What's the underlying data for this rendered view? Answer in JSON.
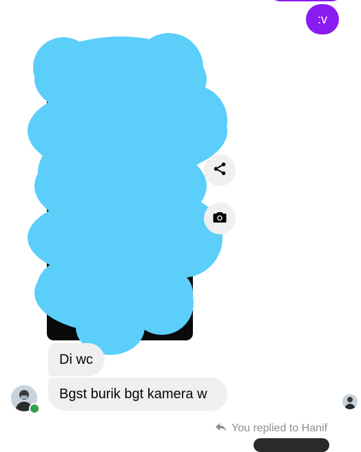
{
  "colors": {
    "brand_purple": "#8a1cf2",
    "incoming_bubble": "#efefef",
    "scribble": "#5bcefa",
    "online": "#31a24c",
    "muted_text": "#8a8d91"
  },
  "messages": {
    "outgoing": [
      {
        "text": ":v"
      }
    ],
    "incoming": [
      {
        "text": "Di wc"
      },
      {
        "text": "Bgst burik bgt kamera w"
      }
    ]
  },
  "image_message": {
    "content": "redacted-photo"
  },
  "actions": {
    "share_icon": "share-icon",
    "camera_icon": "camera-icon"
  },
  "reply_note": {
    "icon": "reply-arrow-icon",
    "text": "You replied to Hanif"
  }
}
